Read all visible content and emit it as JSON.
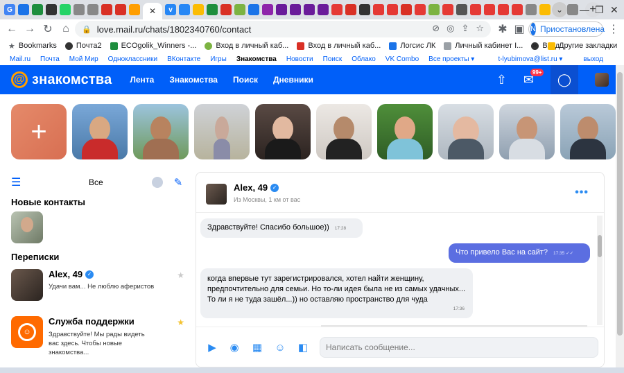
{
  "browser": {
    "url": "love.mail.ru/chats/1802340760/contact",
    "profile_label": "Приостановлена",
    "profile_initial": "N",
    "new_tab": "+",
    "tab_menu": "⌄",
    "window_controls": [
      "—",
      "❐",
      "✕"
    ],
    "bookmarks": [
      {
        "label": "Bookmarks",
        "color": "#5f6368"
      },
      {
        "label": "Почта2",
        "color": "#333"
      },
      {
        "label": "ECOgolik_Winners -...",
        "color": "#1e8e3e"
      },
      {
        "label": "Вход в личный каб...",
        "color": "#7cb342"
      },
      {
        "label": "Вход в личный каб...",
        "color": "#d93025"
      },
      {
        "label": "Логсис ЛК",
        "color": "#1a73e8"
      },
      {
        "label": "Личный кабинет I...",
        "color": "#9aa0a6"
      },
      {
        "label": "Вход",
        "color": "#333"
      }
    ],
    "more_bookmarks": "»",
    "other_bookmarks": "Другие закладки"
  },
  "portal": {
    "links": [
      "Mail.ru",
      "Почта",
      "Мой Мир",
      "Одноклассники",
      "ВКонтакте",
      "Игры",
      "Знакомства",
      "Новости",
      "Поиск",
      "Облако",
      "VK Combo",
      "Все проекты ▾"
    ],
    "active": "Знакомства",
    "user": "t-lyubimova@list.ru ▾",
    "logout": "выход"
  },
  "header": {
    "logo": "знакомства",
    "nav": [
      "Лента",
      "Знакомства",
      "Поиск",
      "Дневники"
    ],
    "notifications_badge": "99+"
  },
  "sidebar": {
    "filter_all": "Все",
    "new_contacts_title": "Новые контакты",
    "chats_title": "Переписки",
    "chats": [
      {
        "name": "Alex, 49",
        "preview": "Удачи вам... Не люблю аферистов",
        "verified": true,
        "star_color": "#c9c9c9"
      },
      {
        "name": "Служба поддержки",
        "preview": "Здравствуйте! Мы рады видеть вас здесь. Чтобы новые знакомства...",
        "verified": false,
        "star_color": "#f3c230"
      }
    ]
  },
  "chat": {
    "name": "Alex, 49",
    "location": "Из Москвы, 1 км от вас",
    "more": "•••",
    "messages": [
      {
        "dir": "in",
        "text": "Здравствуйте! Спасибо большое))",
        "time": "17:28"
      },
      {
        "dir": "out",
        "text": "Что привело Вас на сайт?",
        "time": "17:35"
      },
      {
        "dir": "in",
        "text": "когда впервые тут зарегистрировался, хотел найти женщину, предпочтительно для семьи. Но то-ли идея была не из самых удачных... То ли я не туда зашёл...)) но оставляю пространство для чуда",
        "time": "17:36"
      }
    ],
    "input_placeholder": "Написать сообщение..."
  },
  "colors": {
    "brand_blue": "#005ff9",
    "accent_orange": "#ff9e00",
    "out_bubble": "#5b6ee1",
    "in_bubble": "#eef0f3",
    "badge_red": "#ff3347"
  }
}
